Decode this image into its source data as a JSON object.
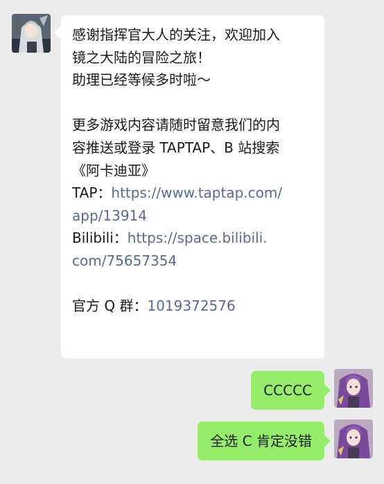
{
  "incoming": {
    "line1": "感谢指挥官大人的关注，欢迎加入",
    "line2": "镜之大陆的冒险之旅！",
    "line3": "助理已经等候多时啦～",
    "line4": "更多游戏内容请随时留意我们的内",
    "line5": "容推送或登录 TAPTAP、B 站搜索",
    "line6": "《阿卡迪亚》",
    "tap_label": "TAP：",
    "tap_link_1": "https://www.taptap.com/",
    "tap_link_2": "app/13914",
    "bili_label": "Bilibili：",
    "bili_link_1": "https://space.bilibili.",
    "bili_link_2": "com/75657354",
    "qq_label": "官方 Q 群：",
    "qq_number": "1019372576"
  },
  "outgoing": [
    {
      "text": "CCCCC"
    },
    {
      "text": "全选 C 肯定没错"
    }
  ],
  "colors": {
    "background": "#ececec",
    "incoming_bubble": "#ffffff",
    "outgoing_bubble": "#95ec69",
    "link": "#576b95"
  }
}
